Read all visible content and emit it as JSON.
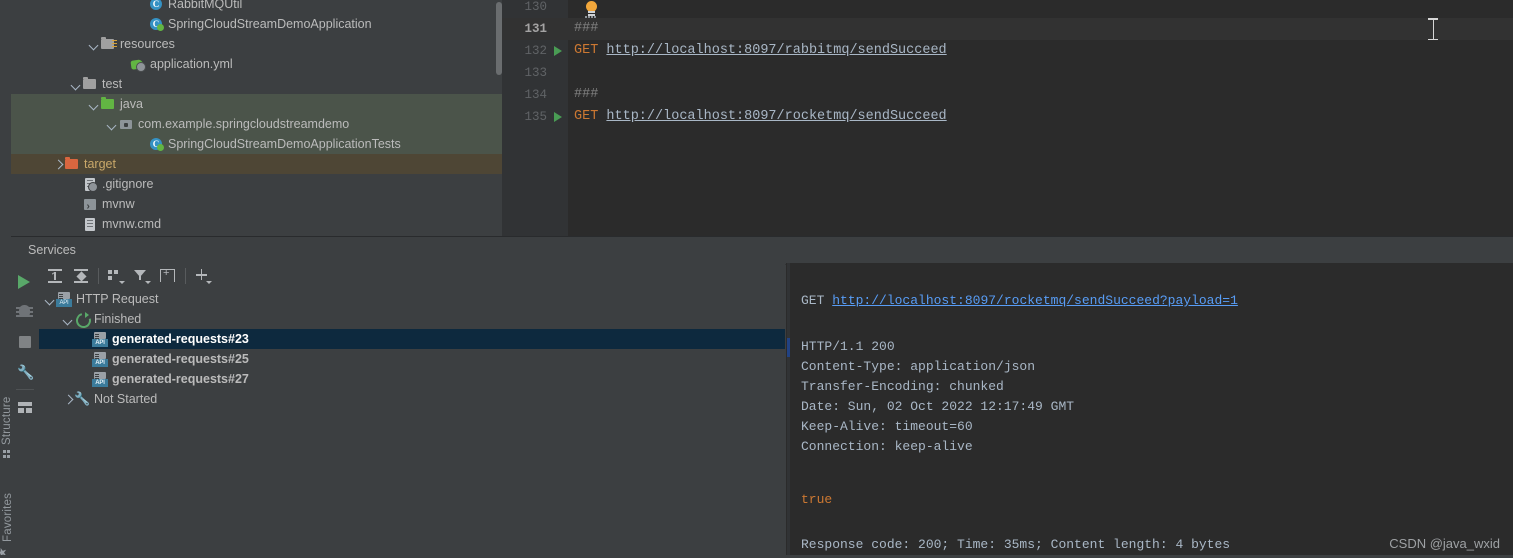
{
  "project_tree": {
    "items": [
      {
        "label": "RabbitMQUtil",
        "indent": 148,
        "icon": "java-class-icon",
        "arrow": "none",
        "row_style": "normal",
        "clipped": true
      },
      {
        "label": "SpringCloudStreamDemoApplication",
        "indent": 148,
        "icon": "spring-boot-class-icon",
        "arrow": "none",
        "row_style": "normal"
      },
      {
        "label": "resources",
        "indent": 100,
        "icon": "resources-folder-icon",
        "arrow": "down",
        "row_style": "normal"
      },
      {
        "label": "application.yml",
        "indent": 130,
        "icon": "yaml-file-icon",
        "arrow": "none",
        "row_style": "normal"
      },
      {
        "label": "test",
        "indent": 82,
        "icon": "folder-icon",
        "arrow": "down",
        "row_style": "normal"
      },
      {
        "label": "java",
        "indent": 100,
        "icon": "test-source-folder-icon",
        "arrow": "down",
        "row_style": "src-test"
      },
      {
        "label": "com.example.springcloudstreamdemo",
        "indent": 118,
        "icon": "package-icon",
        "arrow": "down",
        "row_style": "src-test"
      },
      {
        "label": "SpringCloudStreamDemoApplicationTests",
        "indent": 148,
        "icon": "test-class-icon",
        "arrow": "none",
        "row_style": "src-test"
      },
      {
        "label": "target",
        "indent": 64,
        "icon": "excluded-folder-icon",
        "arrow": "right",
        "row_style": "excluded"
      },
      {
        "label": ".gitignore",
        "indent": 82,
        "icon": "gitignore-file-icon",
        "arrow": "none",
        "row_style": "normal"
      },
      {
        "label": "mvnw",
        "indent": 82,
        "icon": "shell-script-icon",
        "arrow": "none",
        "row_style": "normal"
      },
      {
        "label": "mvnw.cmd",
        "indent": 82,
        "icon": "text-file-icon",
        "arrow": "none",
        "row_style": "normal"
      }
    ]
  },
  "editor": {
    "lines": [
      {
        "num": "130",
        "current": false,
        "runnable": false,
        "tokens": []
      },
      {
        "num": "131",
        "current": true,
        "runnable": false,
        "tokens": [
          {
            "text": "###",
            "cls": "c-comment"
          }
        ]
      },
      {
        "num": "132",
        "current": false,
        "runnable": true,
        "tokens": [
          {
            "text": "GET ",
            "cls": "c-method"
          },
          {
            "text": "http://localhost:8097/rabbitmq/sendSucceed",
            "cls": "c-url"
          }
        ]
      },
      {
        "num": "133",
        "current": false,
        "runnable": false,
        "tokens": []
      },
      {
        "num": "134",
        "current": false,
        "runnable": false,
        "tokens": [
          {
            "text": "###",
            "cls": "c-comment"
          }
        ]
      },
      {
        "num": "135",
        "current": false,
        "runnable": true,
        "tokens": [
          {
            "text": "GET ",
            "cls": "c-method"
          },
          {
            "text": "http://localhost:8097/rocketmq/sendSucceed",
            "cls": "c-url"
          }
        ]
      }
    ]
  },
  "services": {
    "window_title": "Services",
    "left_strip": {
      "structure_label": "Structure",
      "favorites_label": "Favorites"
    },
    "side_actions": [
      {
        "name": "run-button",
        "tooltip": "Run"
      },
      {
        "name": "debug-button",
        "tooltip": "Debug"
      },
      {
        "name": "stop-button",
        "tooltip": "Stop"
      },
      {
        "name": "settings-button",
        "tooltip": "Settings"
      },
      {
        "name": "layout-button",
        "tooltip": "Layout Settings"
      }
    ],
    "toolbar": [
      {
        "name": "expand-all-button",
        "label": "Expand All"
      },
      {
        "name": "collapse-all-button",
        "label": "Collapse All"
      },
      {
        "name": "group-by-button",
        "label": "Group By"
      },
      {
        "name": "filter-button",
        "label": "Filter"
      },
      {
        "name": "add-tab-button",
        "label": "Add Tab"
      },
      {
        "name": "add-service-button",
        "label": "Add Service"
      }
    ],
    "tree": [
      {
        "label": "HTTP Request",
        "depth": 0,
        "arrow": "down",
        "icon": "http-request-icon",
        "selected": false,
        "bold": false
      },
      {
        "label": "Finished",
        "depth": 1,
        "arrow": "down",
        "icon": "finished-icon",
        "selected": false,
        "bold": false
      },
      {
        "label": "generated-requests#23",
        "depth": 2,
        "arrow": "none",
        "icon": "http-request-icon",
        "selected": true,
        "bold": true
      },
      {
        "label": "generated-requests#25",
        "depth": 2,
        "arrow": "none",
        "icon": "http-request-icon",
        "selected": false,
        "bold": true
      },
      {
        "label": "generated-requests#27",
        "depth": 2,
        "arrow": "none",
        "icon": "http-request-icon",
        "selected": false,
        "bold": true
      },
      {
        "label": "Not Started",
        "depth": 1,
        "arrow": "right",
        "icon": "not-started-icon",
        "selected": false,
        "bold": false
      }
    ]
  },
  "response": {
    "request_method": "GET",
    "request_url": "http://localhost:8097/rocketmq/sendSucceed?payload=1",
    "lines": [
      {
        "text": "HTTP/1.1 200",
        "cls": ""
      },
      {
        "text": "Content-Type: application/json",
        "cls": ""
      },
      {
        "text": "Transfer-Encoding: chunked",
        "cls": ""
      },
      {
        "text": "Date: Sun, 02 Oct 2022 12:17:49 GMT",
        "cls": ""
      },
      {
        "text": "Keep-Alive: timeout=60",
        "cls": ""
      },
      {
        "text": "Connection: keep-alive",
        "cls": ""
      }
    ],
    "body": "true",
    "status_line": "Response code: 200; Time: 35ms; Content length: 4 bytes"
  },
  "watermark": "CSDN @java_wxid",
  "colors": {
    "background": "#3c3f41",
    "editor_background": "#2b2b2b",
    "selection": "#0d293e",
    "accent_green": "#59a869",
    "link_blue": "#589df6",
    "keyword_orange": "#cc7832",
    "test_source_green": "#4b544a",
    "excluded_brown": "#4e4635"
  }
}
